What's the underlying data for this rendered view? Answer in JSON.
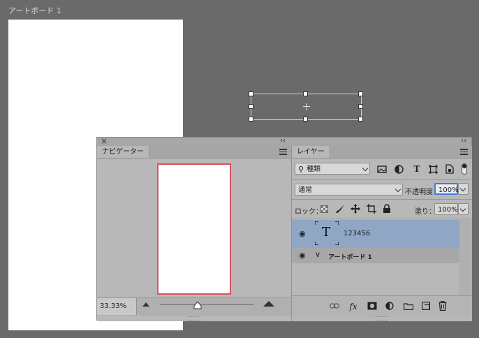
{
  "artboard": {
    "label": "アートボード 1"
  },
  "navigator": {
    "tab_label": "ナビゲーター",
    "zoom_value": "33.33%",
    "zoom_slider_fraction": 0.4
  },
  "layers": {
    "tab_label": "レイヤー",
    "filter_kind": "種類",
    "blend_mode": "通常",
    "opacity_label": "不透明度：",
    "opacity_value": "100%",
    "lock_label": "ロック：",
    "fill_label": "塗り：",
    "fill_value": "100%",
    "items": [
      {
        "name": "123456",
        "type_glyph": "T",
        "selected": true
      },
      {
        "name": "アートボード 1",
        "expanded": true
      }
    ],
    "footer_fx": "fx"
  },
  "icons": {
    "group_close": "×",
    "collapse": "‹‹",
    "search": "⚲",
    "eye": "◉",
    "expand": "∨"
  },
  "colors": {
    "canvas": "#6a6a6a",
    "panel": "#b8b8b8",
    "selected_layer": "#8fa7c5",
    "navigator_view_box": "#d9535c",
    "field_focus": "#3d7de0"
  }
}
